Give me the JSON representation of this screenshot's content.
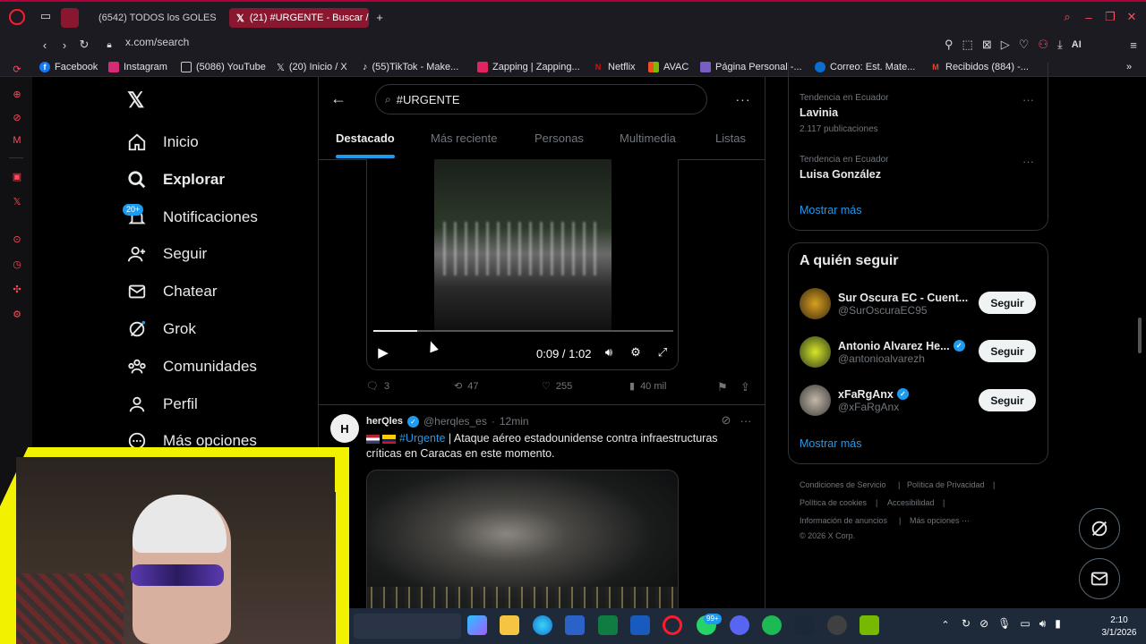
{
  "browser": {
    "tabs": [
      {
        "label": "(6542) TODOS los GOLES"
      },
      {
        "label": "(21) #URGENTE - Buscar /"
      }
    ],
    "url": "x.com/search",
    "bookmarks": [
      {
        "label": "Facebook"
      },
      {
        "label": "Instagram"
      },
      {
        "label": "(5086) YouTube"
      },
      {
        "label": "(20) Inicio / X"
      },
      {
        "label": "(55)TikTok - Make..."
      },
      {
        "label": "Zapping | Zapping..."
      },
      {
        "label": "Netflix"
      },
      {
        "label": "AVAC"
      },
      {
        "label": "Página Personal -..."
      },
      {
        "label": "Correo: Est. Mate..."
      },
      {
        "label": "Recibidos (884) -..."
      }
    ],
    "ai_label": "AI"
  },
  "nav": {
    "items": [
      {
        "label": "Inicio"
      },
      {
        "label": "Explorar"
      },
      {
        "label": "Notificaciones",
        "badge": "20+"
      },
      {
        "label": "Seguir"
      },
      {
        "label": "Chatear"
      },
      {
        "label": "Grok"
      },
      {
        "label": "Comunidades"
      },
      {
        "label": "Perfil"
      },
      {
        "label": "Más opciones"
      }
    ]
  },
  "search": {
    "query": "#URGENTE",
    "tabs": [
      "Destacado",
      "Más reciente",
      "Personas",
      "Multimedia",
      "Listas"
    ]
  },
  "video": {
    "time": "0:09 / 1:02",
    "progress": 0.145
  },
  "post1_actions": {
    "replies": "3",
    "reposts": "47",
    "likes": "255",
    "views": "40 mil"
  },
  "post2": {
    "author": "herQles",
    "handle": "@herqles_es",
    "time": "12min",
    "hashtag": "#Urgente",
    "text": " | Ataque aéreo estadounidense contra infraestructuras críticas en Caracas en este momento."
  },
  "trends": [
    {
      "meta": "Tendencia en Ecuador",
      "title": "Lavinia",
      "count": "2.117 publicaciones"
    },
    {
      "meta": "Tendencia en Ecuador",
      "title": "Luisa González",
      "count": ""
    }
  ],
  "show_more": "Mostrar más",
  "who_to_follow": {
    "title": "A quién seguir",
    "users": [
      {
        "name": "Sur Oscura EC - Cuent...",
        "handle": "@SurOscuraEC95",
        "verified": false
      },
      {
        "name": "Antonio Alvarez He...",
        "handle": "@antonioalvarezh",
        "verified": true
      },
      {
        "name": "xFaRgAnx",
        "handle": "@xFaRgAnx",
        "verified": true
      }
    ],
    "follow_label": "Seguir",
    "show_more": "Mostrar más"
  },
  "footer": {
    "links": [
      "Condiciones de Servicio",
      "Política de Privacidad",
      "Política de cookies",
      "Accesibilidad",
      "Información de anuncios",
      "Más opciones ···"
    ],
    "copyright": "© 2026 X Corp."
  },
  "taskbar": {
    "time": "2:10",
    "date": "3/1/2026",
    "badge": "99+"
  },
  "colors": {
    "accent": "#1d9bf0",
    "tab_active": "#8a1730",
    "yellow": "#f2f200"
  }
}
